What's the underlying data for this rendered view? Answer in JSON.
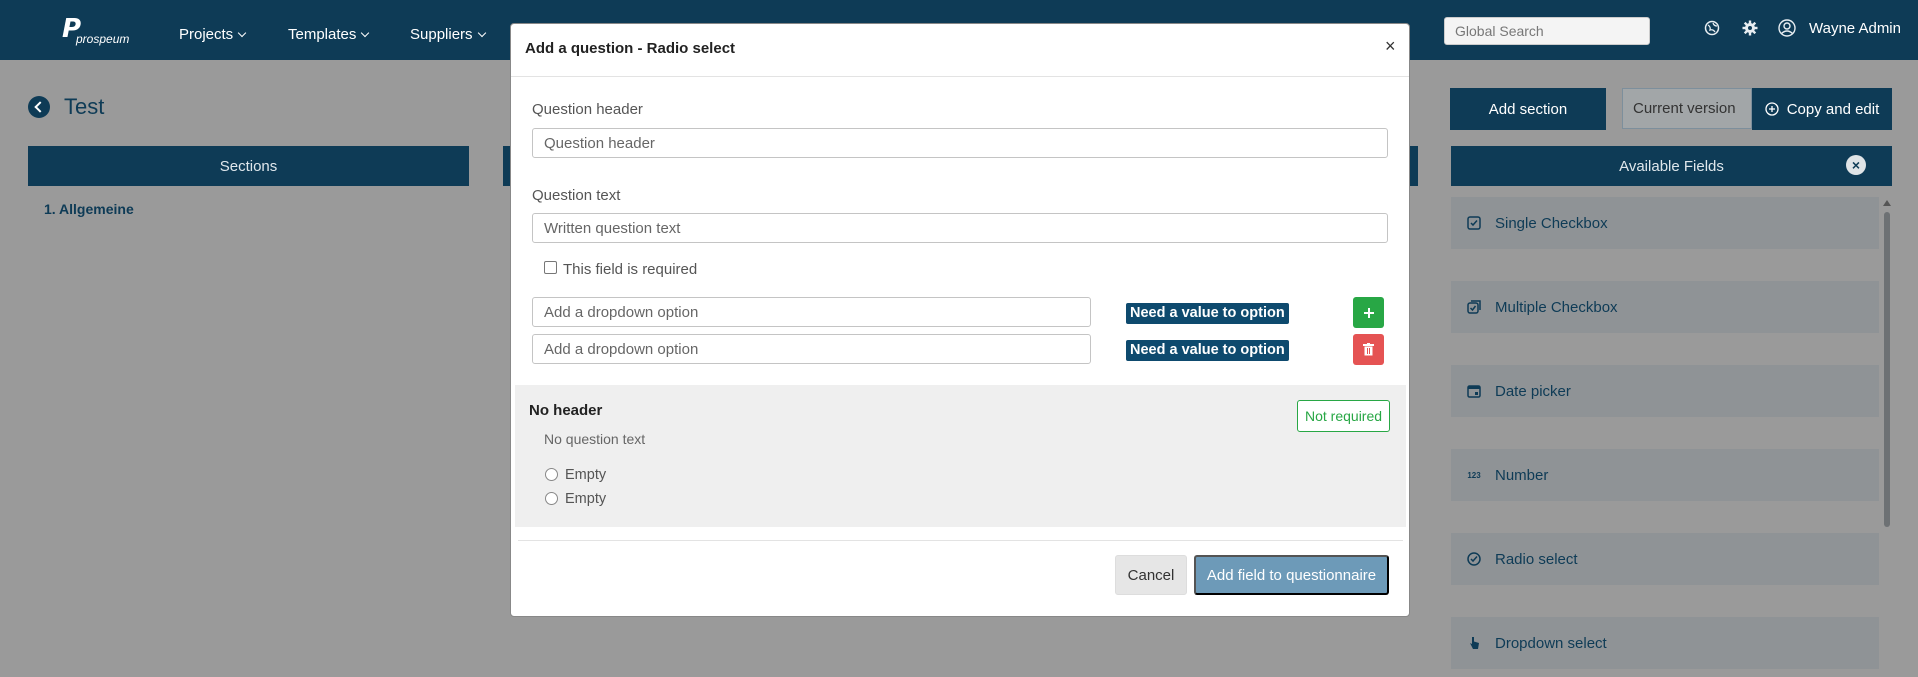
{
  "navbar": {
    "logo_mark": "P",
    "logo_text": "prospeum",
    "items": [
      {
        "label": "Projects"
      },
      {
        "label": "Templates"
      },
      {
        "label": "Suppliers"
      }
    ],
    "search_placeholder": "Global Search",
    "user_name": "Wayne Admin"
  },
  "page": {
    "title": "Test",
    "sections_header": "Sections",
    "sections": [
      {
        "label": "1. Allgemeine"
      }
    ],
    "add_section_label": "Add section",
    "version_label": "Current version",
    "copy_edit_label": "Copy and edit",
    "available_fields_header": "Available Fields",
    "fields": [
      {
        "label": "Single Checkbox",
        "icon": "checkbox-icon"
      },
      {
        "label": "Multiple Checkbox",
        "icon": "multi-checkbox-icon"
      },
      {
        "label": "Date picker",
        "icon": "calendar-icon"
      },
      {
        "label": "Number",
        "icon": "number-icon",
        "icon_text": "123"
      },
      {
        "label": "Radio select",
        "icon": "radio-check-icon"
      },
      {
        "label": "Dropdown select",
        "icon": "pointer-icon"
      }
    ]
  },
  "modal": {
    "title": "Add a question - Radio select",
    "close_glyph": "×",
    "question_header_label": "Question header",
    "question_header_placeholder": "Question header",
    "question_text_label": "Question text",
    "question_text_placeholder": "Written question text",
    "required_label": "This field is required",
    "options": [
      {
        "placeholder": "Add a dropdown option",
        "badge": "Need a value to option",
        "action": "add"
      },
      {
        "placeholder": "Add a dropdown option",
        "badge": "Need a value to option",
        "action": "delete"
      }
    ],
    "preview": {
      "header": "No header",
      "question": "No question text",
      "required_badge": "Not required",
      "options": [
        "Empty",
        "Empty"
      ]
    },
    "cancel_label": "Cancel",
    "submit_label": "Add field to questionnaire"
  },
  "colors": {
    "navy": "#0e3b56",
    "success": "#28a745",
    "danger": "#e74c3c",
    "submit": "#6d9ab8"
  }
}
